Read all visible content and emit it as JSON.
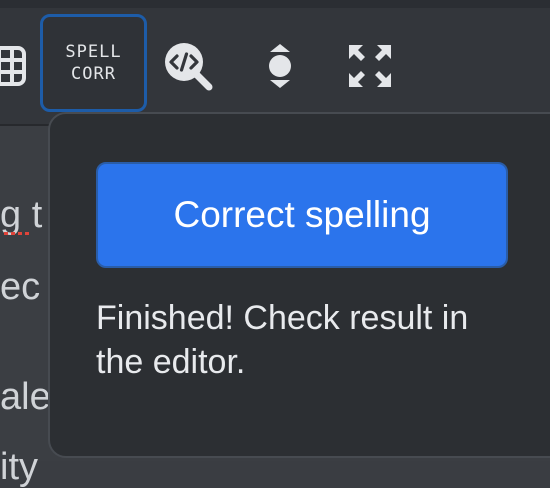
{
  "toolbar": {
    "spell_line1": "SPELL",
    "spell_line2": "CORR",
    "icons": [
      "table-icon",
      "code-search-icon",
      "vertical-resize-icon",
      "fullscreen-icon"
    ]
  },
  "editor": {
    "line1": "g t",
    "line2": "ec",
    "line3": "ale",
    "line4": "ity"
  },
  "popover": {
    "button_label": "Correct spelling",
    "status": "Finished! Check result in the editor."
  },
  "colors": {
    "accent": "#2b74ec",
    "popover_bg": "#2c2f33",
    "toolbar_bg": "#33363b"
  }
}
